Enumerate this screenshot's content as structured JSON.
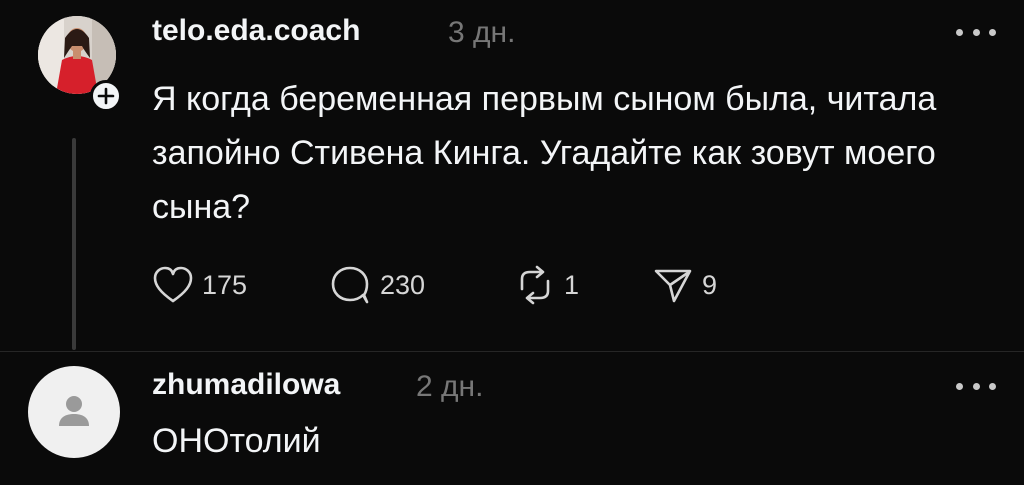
{
  "post": {
    "username": "telo.eda.coach",
    "time": "3 дн.",
    "text": "Я когда беременная первым сыном была, читала запойно Стивена Кинга. Угадайте как зовут моего сына?",
    "likes": "175",
    "comments": "230",
    "reposts": "1",
    "shares": "9"
  },
  "reply": {
    "username": "zhumadilowa",
    "time": "2 дн.",
    "text": "ОНОтолий"
  },
  "icons": {
    "like": "heart-icon",
    "comment": "speech-bubble-icon",
    "repost": "repost-icon",
    "share": "paper-plane-icon",
    "more": "more-dots-icon",
    "follow": "plus-icon",
    "default_avatar": "person-silhouette-icon"
  }
}
